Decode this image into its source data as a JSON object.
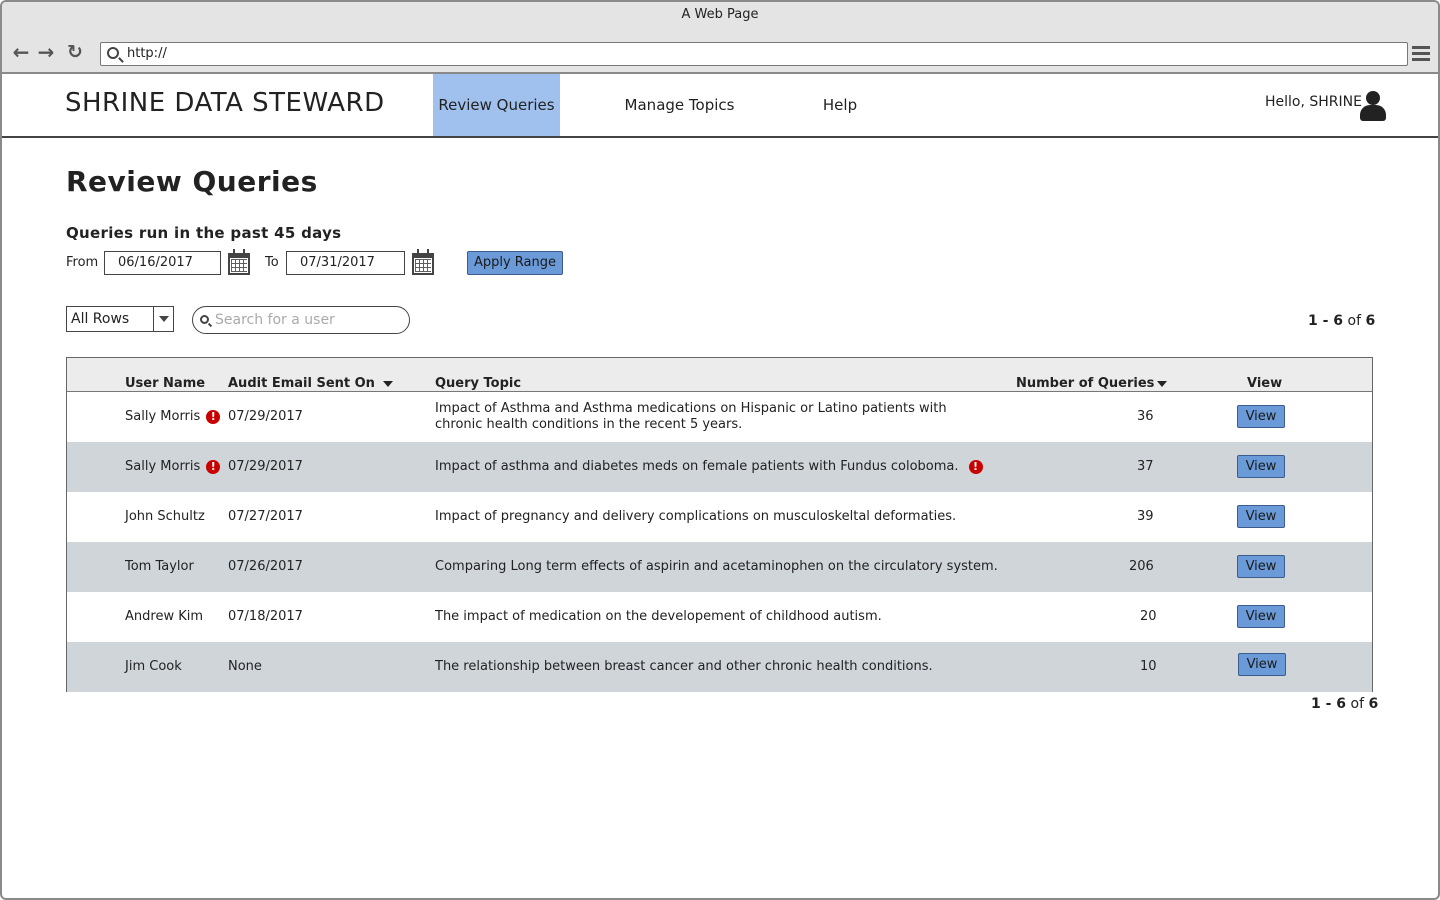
{
  "browser": {
    "title": "A Web Page",
    "url": "http://"
  },
  "header": {
    "brand": "SHRINE DATA STEWARD",
    "nav": [
      "Review Queries",
      "Manage Topics",
      "Help"
    ],
    "active_nav": "Review Queries",
    "greeting": "Hello, SHRINE"
  },
  "page": {
    "title": "Review Queries",
    "range_title": "Queries run in the past 45 days",
    "from_label": "From",
    "from_value": "06/16/2017",
    "to_label": "To",
    "to_value": "07/31/2017",
    "apply_label": "Apply Range",
    "rows_select": "All Rows",
    "search_placeholder": "Search for a user",
    "pager": {
      "range": "1 - 6",
      "of": "of",
      "total": "6"
    }
  },
  "table": {
    "headers": {
      "user": "User Name",
      "email": "Audit Email Sent On",
      "topic": "Query Topic",
      "count": "Number of Queries",
      "view": "View"
    },
    "rows": [
      {
        "user": "Sally Morris",
        "user_flag": true,
        "email": "07/29/2017",
        "topic": "Impact of Asthma and Asthma medications on Hispanic or Latino patients with chronic health conditions in the recent 5 years.",
        "topic_flag": false,
        "count": "36",
        "view": "View"
      },
      {
        "user": "Sally Morris",
        "user_flag": true,
        "email": "07/29/2017",
        "topic": "Impact of asthma and diabetes meds on female patients with Fundus coloboma.",
        "topic_flag": true,
        "count": "37",
        "view": "View"
      },
      {
        "user": "John Schultz",
        "user_flag": false,
        "email": "07/27/2017",
        "topic": "Impact of pregnancy and delivery complications on musculoskeltal deformaties.",
        "topic_flag": false,
        "count": "39",
        "view": "View"
      },
      {
        "user": "Tom Taylor",
        "user_flag": false,
        "email": "07/26/2017",
        "topic": "Comparing Long term effects of aspirin and acetaminophen on the circulatory system.",
        "topic_flag": false,
        "count": "206",
        "view": "View"
      },
      {
        "user": "Andrew Kim",
        "user_flag": false,
        "email": "07/18/2017",
        "topic": "The impact of medication on the developement of childhood autism.",
        "topic_flag": false,
        "count": "20",
        "view": "View"
      },
      {
        "user": "Jim Cook",
        "user_flag": false,
        "email": "None",
        "topic": "The relationship between breast cancer and other chronic health conditions.",
        "topic_flag": false,
        "count": "10",
        "view": "View"
      }
    ]
  },
  "icons": {
    "warn_glyph": "!"
  },
  "colors": {
    "active_tab": "#a0c0ee",
    "button_blue": "#6a9ad8",
    "row_alt": "#d0d5da",
    "warning_red": "#c80000"
  }
}
